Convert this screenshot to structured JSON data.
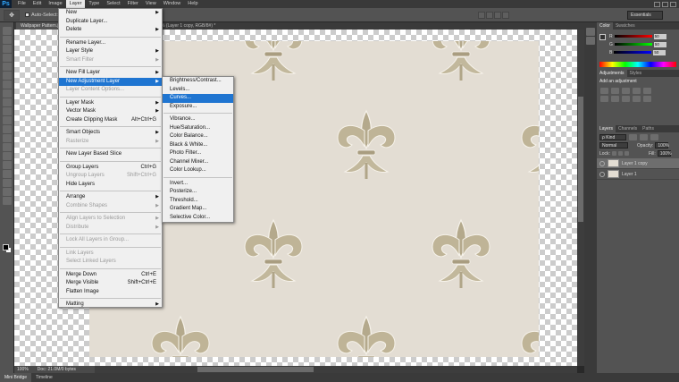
{
  "app": {
    "logo": "Ps"
  },
  "menubar": {
    "items": [
      "File",
      "Edit",
      "Image",
      "Layer",
      "Type",
      "Select",
      "Filter",
      "View",
      "Window",
      "Help"
    ],
    "active_index": 3
  },
  "options_bar": {
    "auto_select_label": "Auto-Select:",
    "workspace": "Essentials"
  },
  "document": {
    "tab_title": "Wallpaper Pattern.j",
    "tab_title_2": "% (Layer 1 copy, RGB/8#) *",
    "zoom": "100%",
    "doc_size": "Doc: 21.0M/0 bytes"
  },
  "bottom_tabs": [
    "Mini Bridge",
    "Timeline"
  ],
  "layer_menu": [
    {
      "label": "New",
      "sub": true
    },
    {
      "label": "Duplicate Layer..."
    },
    {
      "label": "Delete",
      "sub": true
    },
    {
      "sep": true
    },
    {
      "label": "Rename Layer..."
    },
    {
      "label": "Layer Style",
      "sub": true
    },
    {
      "label": "Smart Filter",
      "disabled": true,
      "sub": true
    },
    {
      "sep": true
    },
    {
      "label": "New Fill Layer",
      "sub": true
    },
    {
      "label": "New Adjustment Layer",
      "sub": true,
      "highlight": true
    },
    {
      "label": "Layer Content Options...",
      "disabled": true
    },
    {
      "sep": true
    },
    {
      "label": "Layer Mask",
      "sub": true
    },
    {
      "label": "Vector Mask",
      "sub": true
    },
    {
      "label": "Create Clipping Mask",
      "shortcut": "Alt+Ctrl+G"
    },
    {
      "sep": true
    },
    {
      "label": "Smart Objects",
      "sub": true
    },
    {
      "label": "Rasterize",
      "disabled": true,
      "sub": true
    },
    {
      "sep": true
    },
    {
      "label": "New Layer Based Slice"
    },
    {
      "sep": true
    },
    {
      "label": "Group Layers",
      "shortcut": "Ctrl+G"
    },
    {
      "label": "Ungroup Layers",
      "shortcut": "Shift+Ctrl+G",
      "disabled": true
    },
    {
      "label": "Hide Layers"
    },
    {
      "sep": true
    },
    {
      "label": "Arrange",
      "sub": true
    },
    {
      "label": "Combine Shapes",
      "disabled": true,
      "sub": true
    },
    {
      "sep": true
    },
    {
      "label": "Align Layers to Selection",
      "disabled": true,
      "sub": true
    },
    {
      "label": "Distribute",
      "disabled": true,
      "sub": true
    },
    {
      "sep": true
    },
    {
      "label": "Lock All Layers in Group...",
      "disabled": true
    },
    {
      "sep": true
    },
    {
      "label": "Link Layers",
      "disabled": true
    },
    {
      "label": "Select Linked Layers",
      "disabled": true
    },
    {
      "sep": true
    },
    {
      "label": "Merge Down",
      "shortcut": "Ctrl+E"
    },
    {
      "label": "Merge Visible",
      "shortcut": "Shift+Ctrl+E"
    },
    {
      "label": "Flatten Image"
    },
    {
      "sep": true
    },
    {
      "label": "Matting",
      "sub": true
    }
  ],
  "adjustment_submenu": [
    {
      "label": "Brightness/Contrast..."
    },
    {
      "label": "Levels..."
    },
    {
      "label": "Curves...",
      "highlight": true
    },
    {
      "label": "Exposure..."
    },
    {
      "sep": true
    },
    {
      "label": "Vibrance..."
    },
    {
      "label": "Hue/Saturation..."
    },
    {
      "label": "Color Balance..."
    },
    {
      "label": "Black & White..."
    },
    {
      "label": "Photo Filter..."
    },
    {
      "label": "Channel Mixer..."
    },
    {
      "label": "Color Lookup..."
    },
    {
      "sep": true
    },
    {
      "label": "Invert..."
    },
    {
      "label": "Posterize..."
    },
    {
      "label": "Threshold..."
    },
    {
      "label": "Gradient Map..."
    },
    {
      "label": "Selective Color..."
    }
  ],
  "panels": {
    "color_tabs": [
      "Color",
      "Swatches"
    ],
    "color_sliders": [
      {
        "channel": "R",
        "value": "50",
        "gradient": "linear-gradient(90deg,#000,#f00)"
      },
      {
        "channel": "G",
        "value": "50",
        "gradient": "linear-gradient(90deg,#000,#0f0)"
      },
      {
        "channel": "B",
        "value": "50",
        "gradient": "linear-gradient(90deg,#000,#00f)"
      }
    ],
    "adjust_tabs": [
      "Adjustments",
      "Styles"
    ],
    "adjust_title": "Add an adjustment",
    "layer_tabs": [
      "Layers",
      "Channels",
      "Paths"
    ],
    "kind_filter": "Kind",
    "blend_mode": "Normal",
    "opacity_label": "Opacity:",
    "opacity_value": "100%",
    "lock_label": "Lock:",
    "fill_label": "Fill:",
    "fill_value": "100%",
    "layers": [
      {
        "name": "Layer 1 copy",
        "selected": true
      },
      {
        "name": "Layer 1",
        "selected": false
      }
    ]
  }
}
